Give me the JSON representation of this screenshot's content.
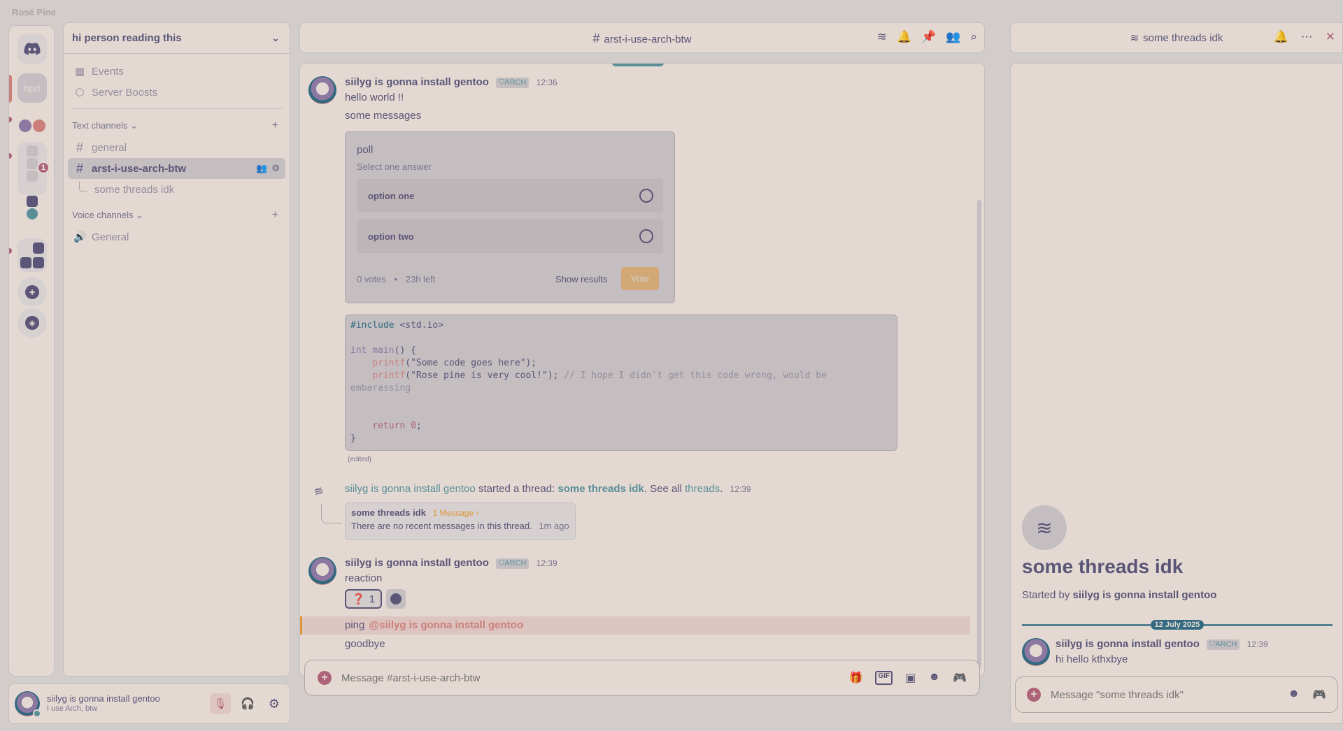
{
  "app": {
    "title": "Rosé Pine"
  },
  "rail": {
    "servers": [
      {
        "name": "home",
        "icon": "discord-icon"
      },
      {
        "name": "hprt",
        "label": "hprt"
      },
      {
        "name": "server-3"
      },
      {
        "name": "folder-1",
        "badge": "1"
      },
      {
        "name": "server-5"
      },
      {
        "name": "folder-2"
      }
    ],
    "add_server": "add-server-icon",
    "explore": "compass-icon"
  },
  "sidebar": {
    "server_name": "hi person reading this",
    "items": [
      {
        "label": "Events",
        "icon": "calendar-icon"
      },
      {
        "label": "Server Boosts",
        "icon": "boost-icon"
      }
    ],
    "text_category": "Text channels",
    "text_channels": [
      {
        "label": "general"
      },
      {
        "label": "arst-i-use-arch-btw",
        "active": true
      },
      {
        "label": "some threads idk",
        "thread": true
      }
    ],
    "voice_category": "Voice channels",
    "voice_channels": [
      {
        "label": "General"
      }
    ]
  },
  "user": {
    "name": "siilyg is gonna install gentoo",
    "status": "I use Arch, btw"
  },
  "chat": {
    "channel": "arst-i-use-arch-btw",
    "messages": {
      "m1": {
        "author": "siilyg is gonna install gentoo",
        "tag": "ARCH",
        "time": "12:36",
        "line1": "hello world !!",
        "line2": "some messages"
      },
      "poll": {
        "question": "poll",
        "hint": "Select one answer",
        "options": [
          "option one",
          "option two"
        ],
        "votes": "0 votes",
        "sep": "•",
        "time_left": "23h left",
        "show_results": "Show results",
        "vote": "Vote"
      },
      "edited": "(edited)",
      "thread_start": {
        "author": "siilyg is gonna install gentoo",
        "text1": "started a thread:",
        "thread_name": "some threads idk",
        "text2": ". See all",
        "link": "threads",
        "text3": ".",
        "time": "12:39"
      },
      "thread_card": {
        "title": "some threads idk",
        "count": "1 Message ›",
        "body": "There are no recent messages in this thread.",
        "ago": "1m ago"
      },
      "m2": {
        "author": "siilyg is gonna install gentoo",
        "tag": "ARCH",
        "time": "12:39",
        "text": "reaction",
        "reaction_emoji": "❓",
        "reaction_count": "1",
        "ping_text": "ping",
        "mention": "@siilyg is gonna install gentoo",
        "last": "goodbye"
      }
    },
    "composer_placeholder": "Message #arst-i-use-arch-btw"
  },
  "code_lines": {
    "l1a": "#include",
    "l1b": " <std.io>",
    "l3a": "int",
    "l3b": " main",
    "l3c": "() {",
    "l4a": "printf",
    "l4b": "(\"Some code goes here\");",
    "l5a": "printf",
    "l5b": "(\"Rose pine is very cool!\"); ",
    "l5c": "// I hope I didn't get this code wrong, would be embarassing",
    "l8a": "return",
    "l8b": "0",
    "l8c": ";",
    "l9": "}"
  },
  "thread_panel": {
    "title": "some threads idk",
    "big_title": "some threads idk",
    "started_by": "Started by",
    "starter": "siilyg is gonna install gentoo",
    "date": "12 July 2025",
    "message": {
      "author": "siilyg is gonna install gentoo",
      "tag": "ARCH",
      "time": "12:39",
      "text": "hi hello kthxbye"
    },
    "composer_placeholder": "Message \"some threads idk\""
  },
  "colors": {
    "base": "#faf4ed",
    "surface": "#f2e9e1",
    "text": "#575279",
    "love": "#b4637a",
    "gold": "#ea9d34",
    "rose": "#d7827e",
    "pine": "#286983",
    "foam": "#56949f",
    "iris": "#907aa9"
  }
}
